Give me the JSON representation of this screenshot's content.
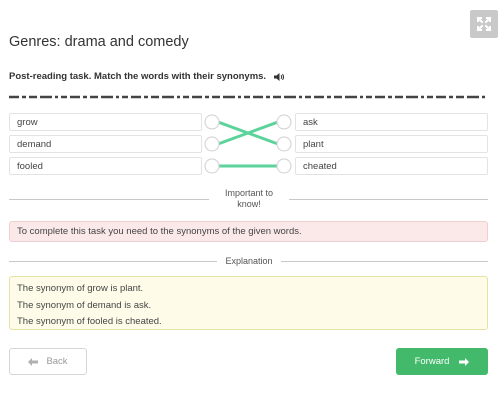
{
  "header": {
    "title": "Genres: drama and comedy",
    "expand_icon": "expand-arrows-icon"
  },
  "task": {
    "instruction": "Post-reading task. Match the words with their synonyms.",
    "audio_icon": "speaker-icon"
  },
  "left_words": [
    "grow",
    "demand",
    "fooled"
  ],
  "right_words": [
    "ask",
    "plant",
    "cheated"
  ],
  "connections": [
    {
      "from": "grow",
      "to": "plant"
    },
    {
      "from": "demand",
      "to": "ask"
    },
    {
      "from": "fooled",
      "to": "cheated"
    }
  ],
  "important": {
    "label": "Important to know!",
    "text": "To complete this task you need to the synonyms of the given words."
  },
  "explanation": {
    "label": "Explanation",
    "lines": [
      "The synonym of grow is plant.",
      "The synonym of demand is ask.",
      "The synonym of fooled is cheated."
    ]
  },
  "nav": {
    "back_label": "Back",
    "forward_label": "Forward"
  },
  "colors": {
    "accent_green": "#43b96c",
    "connector_green": "#5bd39b",
    "info_bg": "#fbe9ea",
    "explain_bg": "#fefce9"
  }
}
